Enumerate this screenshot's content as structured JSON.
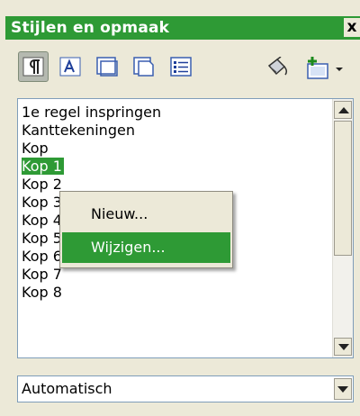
{
  "window": {
    "title": "Stijlen en opmaak",
    "close_label": "x"
  },
  "toolbar": {
    "buttons": [
      {
        "icon": "paragraph-styles-icon"
      },
      {
        "icon": "character-styles-icon"
      },
      {
        "icon": "frame-styles-icon"
      },
      {
        "icon": "page-styles-icon"
      },
      {
        "icon": "list-styles-icon"
      },
      {
        "icon": "fill-format-icon"
      },
      {
        "icon": "new-style-from-selection-icon"
      }
    ]
  },
  "styles_list": {
    "items": [
      "1e regel inspringen",
      "Kanttekeningen",
      "Kop",
      "Kop 1",
      "Kop 2",
      "Kop 3",
      "Kop 4",
      "Kop 5",
      "Kop 6",
      "Kop 7",
      "Kop 8"
    ],
    "selected": "Kop 1"
  },
  "context_menu": {
    "items": [
      "Nieuw...",
      "Wijzigen..."
    ],
    "highlighted": "Wijzigen..."
  },
  "filter": {
    "value": "Automatisch"
  },
  "colors": {
    "accent": "#2e9a35",
    "panel": "#ece9d8"
  }
}
